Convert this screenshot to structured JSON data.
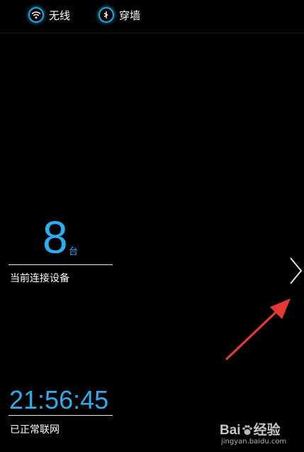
{
  "topbar": {
    "tabs": [
      {
        "label": "无线",
        "icon": "wifi-icon"
      },
      {
        "label": "穿墙",
        "icon": "arrow-right-circle-icon"
      }
    ]
  },
  "devices": {
    "count": "8",
    "unit": "台",
    "label": "当前连接设备"
  },
  "uptime": {
    "time": "21:56:45",
    "status": "已正常联网"
  },
  "navigation": {
    "next_icon": "chevron-right-icon"
  },
  "annotation": {
    "icon": "red-arrow-icon"
  },
  "watermark": {
    "brand_left": "Bai",
    "brand_right": "经验",
    "url": "jingyan.baidu.com"
  },
  "colors": {
    "accent": "#29aef0",
    "background": "#000000",
    "annotation": "#e53935"
  }
}
